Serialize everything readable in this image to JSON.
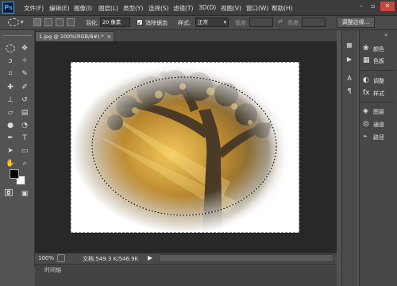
{
  "app": {
    "logo": "Ps"
  },
  "menu": [
    "文件(F)",
    "编辑(E)",
    "图像(I)",
    "图层(L)",
    "类型(Y)",
    "选择(S)",
    "滤镜(T)",
    "3D(D)",
    "视图(V)",
    "窗口(W)",
    "帮助(H)"
  ],
  "options": {
    "feather_label": "羽化:",
    "feather_value": "20 像素",
    "antialias_label": "消除锯齿",
    "style_label": "样式:",
    "style_value": "正常",
    "width_label": "宽度:",
    "height_label": "高度:",
    "refine_edge": "调整边缘..."
  },
  "document": {
    "tab_title": "1.jpg @ 100%(RGB/8#) *"
  },
  "status": {
    "zoom": "100%",
    "doc_info": "文档:549.3 K/546.9K"
  },
  "timeline": {
    "label": "时间轴"
  },
  "panels": {
    "items": [
      "颜色",
      "色板",
      "调整",
      "样式",
      "图层",
      "通道",
      "路径"
    ]
  },
  "colors": {
    "accent": "#31a8ff",
    "menubar": "#3c3c3c",
    "canvas_bg": "#282828",
    "close": "#c8463d"
  }
}
